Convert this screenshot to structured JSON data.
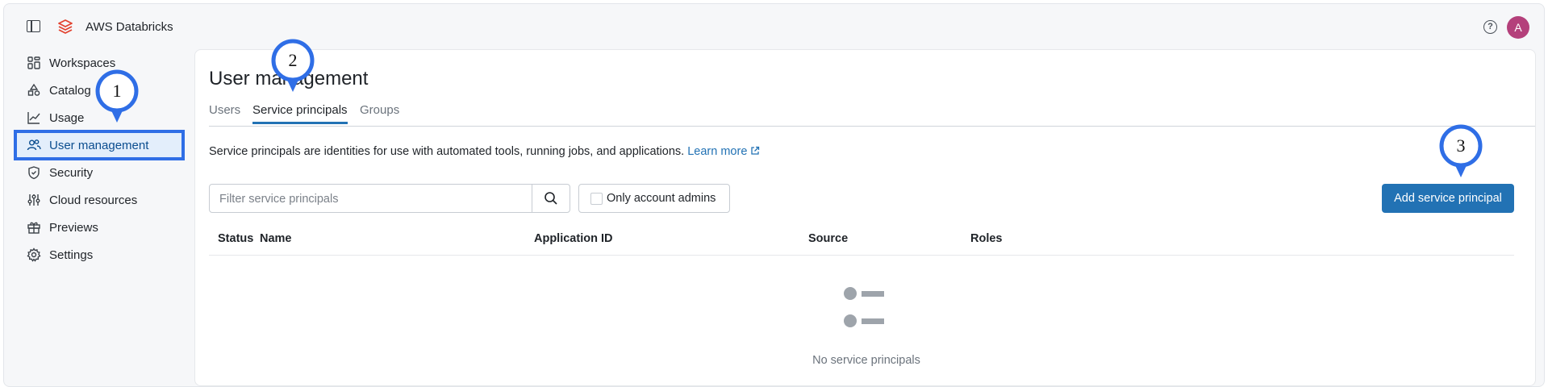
{
  "app": {
    "title": "AWS Databricks"
  },
  "header": {
    "help_icon": "help-icon",
    "avatar_initial": "A",
    "avatar_color": "#b4407b"
  },
  "sidebar": {
    "items": [
      {
        "label": "Workspaces",
        "icon": "workspaces-icon"
      },
      {
        "label": "Catalog",
        "icon": "catalog-icon"
      },
      {
        "label": "Usage",
        "icon": "usage-chart-icon"
      },
      {
        "label": "User management",
        "icon": "users-icon",
        "active": true
      },
      {
        "label": "Security",
        "icon": "shield-icon"
      },
      {
        "label": "Cloud resources",
        "icon": "sliders-icon"
      },
      {
        "label": "Previews",
        "icon": "gift-icon"
      },
      {
        "label": "Settings",
        "icon": "gear-icon"
      }
    ]
  },
  "main": {
    "title": "User management",
    "tabs": [
      {
        "label": "Users"
      },
      {
        "label": "Service principals",
        "active": true
      },
      {
        "label": "Groups"
      }
    ],
    "description": "Service principals are identities for use with automated tools, running jobs, and applications.",
    "learn_more": "Learn more",
    "search": {
      "placeholder": "Filter service principals",
      "value": ""
    },
    "admins_toggle_label": "Only account admins",
    "add_button_label": "Add service principal",
    "table": {
      "columns": [
        "Status",
        "Name",
        "Application ID",
        "Source",
        "Roles"
      ],
      "rows": []
    },
    "empty_text": "No service principals"
  },
  "callouts": [
    "1",
    "2",
    "3"
  ],
  "colors": {
    "accent": "#2272b4",
    "callout": "#2f6ee6",
    "brand": "#e2422f"
  }
}
